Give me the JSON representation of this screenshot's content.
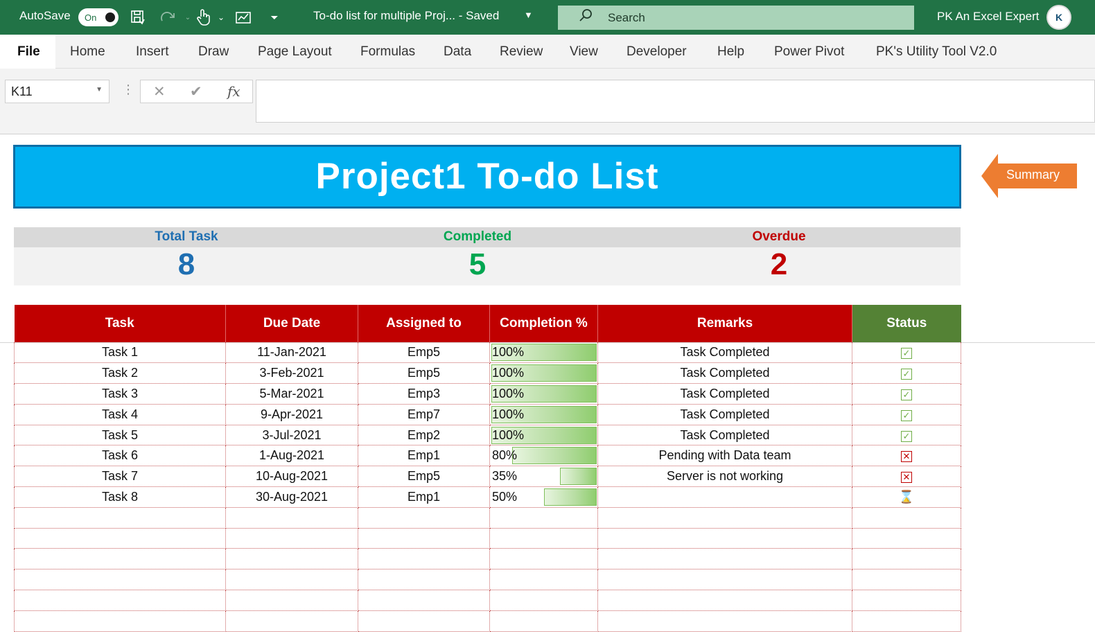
{
  "titlebar": {
    "autosave_label": "AutoSave",
    "autosave_state": "On",
    "doc_title": "To-do list for multiple Proj...  -  Saved",
    "search_placeholder": "Search",
    "user_name": "PK An Excel Expert",
    "avatar_text": "K"
  },
  "ribbon": {
    "tabs": [
      "File",
      "Home",
      "Insert",
      "Draw",
      "Page Layout",
      "Formulas",
      "Data",
      "Review",
      "View",
      "Developer",
      "Help",
      "Power Pivot",
      "PK's Utility Tool V2.0"
    ]
  },
  "formula_bar": {
    "name_box": "K11",
    "cancel_icon": "✕",
    "enter_icon": "✔",
    "fx_icon": "fx",
    "formula": ""
  },
  "sheet": {
    "banner_title": "Project1 To-do List",
    "summary_button": "Summary",
    "stats": {
      "total_label": "Total Task",
      "total_value": "8",
      "completed_label": "Completed",
      "completed_value": "5",
      "overdue_label": "Overdue",
      "overdue_value": "2",
      "colors": {
        "total": "#1f6fb2",
        "completed": "#00a651",
        "overdue": "#c00000"
      }
    },
    "table": {
      "headers": [
        "Task",
        "Due Date",
        "Assigned to",
        "Completion %",
        "Remarks",
        "Status"
      ],
      "rows": [
        {
          "task": "Task 1",
          "due": "11-Jan-2021",
          "assigned": "Emp5",
          "pct_label": "100%",
          "pct": 1.0,
          "remarks": "Task Completed",
          "status": "completed"
        },
        {
          "task": "Task 2",
          "due": "3-Feb-2021",
          "assigned": "Emp5",
          "pct_label": "100%",
          "pct": 1.0,
          "remarks": "Task Completed",
          "status": "completed"
        },
        {
          "task": "Task 3",
          "due": "5-Mar-2021",
          "assigned": "Emp3",
          "pct_label": "100%",
          "pct": 1.0,
          "remarks": "Task Completed",
          "status": "completed"
        },
        {
          "task": "Task 4",
          "due": "9-Apr-2021",
          "assigned": "Emp7",
          "pct_label": "100%",
          "pct": 1.0,
          "remarks": "Task Completed",
          "status": "completed"
        },
        {
          "task": "Task 5",
          "due": "3-Jul-2021",
          "assigned": "Emp2",
          "pct_label": "100%",
          "pct": 1.0,
          "remarks": "Task Completed",
          "status": "completed"
        },
        {
          "task": "Task 6",
          "due": "1-Aug-2021",
          "assigned": "Emp1",
          "pct_label": "80%",
          "pct": 0.8,
          "remarks": "Pending with Data team",
          "status": "overdue"
        },
        {
          "task": "Task 7",
          "due": "10-Aug-2021",
          "assigned": "Emp5",
          "pct_label": "35%",
          "pct": 0.35,
          "remarks": "Server is not working",
          "status": "overdue"
        },
        {
          "task": "Task 8",
          "due": "30-Aug-2021",
          "assigned": "Emp1",
          "pct_label": "50%",
          "pct": 0.5,
          "remarks": "",
          "status": "in-progress"
        }
      ],
      "empty_rows": 6
    }
  }
}
